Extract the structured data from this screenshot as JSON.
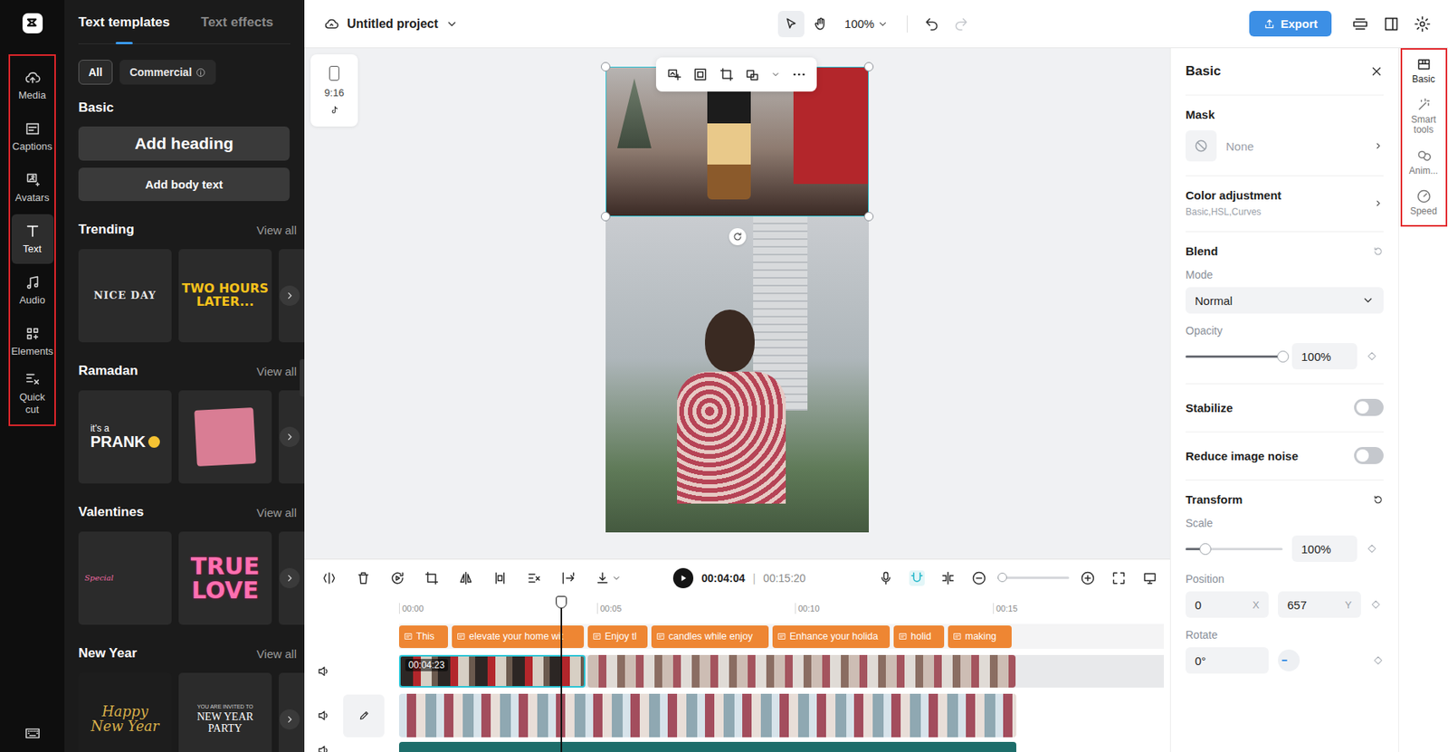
{
  "rail": {
    "items": [
      {
        "label": "Media",
        "selected": false
      },
      {
        "label": "Captions",
        "selected": false
      },
      {
        "label": "Avatars",
        "selected": false
      },
      {
        "label": "Text",
        "selected": true
      },
      {
        "label": "Audio",
        "selected": false
      },
      {
        "label": "Elements",
        "selected": false
      },
      {
        "label": "Quick cut",
        "selected": false
      }
    ]
  },
  "panel": {
    "tabs": [
      {
        "label": "Text templates",
        "selected": true
      },
      {
        "label": "Text effects",
        "selected": false
      }
    ],
    "filters": [
      {
        "label": "All",
        "selected": true
      },
      {
        "label": "Commercial",
        "selected": false
      }
    ],
    "basic": {
      "title": "Basic",
      "heading": "Add heading",
      "body": "Add body text"
    },
    "sections": [
      {
        "title": "Trending",
        "view_all": "View all",
        "cards": [
          {
            "kind": "outline",
            "lines": [
              "NICE DAY"
            ]
          },
          {
            "kind": "yellow",
            "lines": [
              "TWO HOURS",
              "LATER..."
            ]
          }
        ]
      },
      {
        "title": "Ramadan",
        "view_all": "View all",
        "cards": [
          {
            "kind": "prank",
            "lines": [
              "it's a",
              "PRANK"
            ]
          },
          {
            "kind": "pink",
            "lines": []
          }
        ]
      },
      {
        "title": "Valentines",
        "view_all": "View all",
        "cards": [
          {
            "kind": "script",
            "lines": [
              "Special"
            ]
          },
          {
            "kind": "love",
            "lines": [
              "TRUE",
              "LOVE"
            ]
          }
        ]
      },
      {
        "title": "New Year",
        "view_all": "View all",
        "cards": [
          {
            "kind": "gold",
            "lines": [
              "Happy",
              "New Year"
            ]
          },
          {
            "kind": "party",
            "lines": [
              "YOU ARE INVITED TO",
              "NEW YEAR",
              "PARTY"
            ]
          }
        ]
      }
    ]
  },
  "topbar": {
    "project": "Untitled project",
    "tools": [
      {
        "name": "select",
        "selected": true
      },
      {
        "name": "hand",
        "selected": false
      }
    ],
    "zoom": "100%",
    "undo_disabled": false,
    "redo_disabled": true,
    "export": "Export"
  },
  "canvas": {
    "ratio": "9:16"
  },
  "timeline": {
    "current": "00:04:04",
    "separator": "|",
    "duration": "00:15:20",
    "zoom_level": 0.07,
    "ruler": [
      "00:00",
      "00:05",
      "00:10",
      "00:15"
    ],
    "captions": [
      "This",
      "elevate your home wit",
      "Enjoy tl",
      "candles while enjoy",
      "Enhance your holida",
      "holid",
      "making"
    ],
    "clips": [
      {
        "label": "00:04:23",
        "selected": true
      },
      {
        "label": "",
        "selected": false
      }
    ]
  },
  "inspector": {
    "title": "Basic",
    "mask_label": "Mask",
    "mask_value": "None",
    "color_label": "Color adjustment",
    "color_sub": "Basic,HSL,Curves",
    "blend_label": "Blend",
    "mode_label": "Mode",
    "mode_value": "Normal",
    "opacity_label": "Opacity",
    "opacity_value": "100%",
    "opacity_level": 1,
    "toggles": [
      {
        "label": "Stabilize",
        "on": false
      },
      {
        "label": "Reduce image noise",
        "on": false
      }
    ],
    "transform_label": "Transform",
    "scale_label": "Scale",
    "scale_value": "100%",
    "scale_level": 0.2,
    "position_label": "Position",
    "position": [
      {
        "value": "0",
        "axis": "X"
      },
      {
        "value": "657",
        "axis": "Y"
      }
    ],
    "rotate_label": "Rotate",
    "rotate_value": "0°"
  },
  "inspector_rail": {
    "items": [
      {
        "label": "Basic",
        "selected": true
      },
      {
        "label": "Smart tools",
        "selected": false
      },
      {
        "label": "Anim...",
        "selected": false
      },
      {
        "label": "Speed",
        "selected": false
      }
    ]
  }
}
